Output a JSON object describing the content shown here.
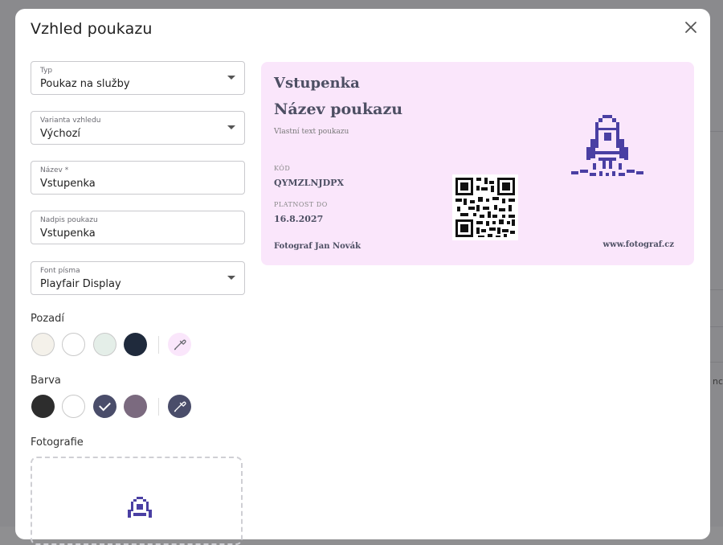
{
  "background": {
    "partial_text": "nc"
  },
  "modal": {
    "title": "Vzhled poukazu"
  },
  "fields": {
    "typ": {
      "label": "Typ",
      "value": "Poukaz na služby"
    },
    "varianta": {
      "label": "Varianta vzhledu",
      "value": "Výchozí"
    },
    "nazev": {
      "label": "Název *",
      "value": "Vstupenka"
    },
    "nadpis": {
      "label": "Nadpis poukazu",
      "value": "Vstupenka"
    },
    "font": {
      "label": "Font písma",
      "value": "Playfair Display"
    }
  },
  "background_colors": {
    "label": "Pozadí",
    "swatches": [
      "#f4f1ea",
      "#ffffff",
      "#e4eee8",
      "#1f2a3c"
    ],
    "custom_color": "#fae6fb",
    "icon": "eyedropper-icon"
  },
  "text_colors": {
    "label": "Barva",
    "swatches": [
      "#2d2d2d",
      "#ffffff",
      "#4a4d6a",
      "#7b6a7f"
    ],
    "selected_index": 2,
    "custom_color": "#4a4d6a",
    "icon": "eyedropper-icon"
  },
  "photo": {
    "label": "Fotografie",
    "icon": "rocket-icon"
  },
  "voucher": {
    "background": "#fae6fb",
    "accent": "#4a3fa3",
    "heading": "Vstupenka",
    "name": "Název poukazu",
    "custom_text": "Vlastní text poukazu",
    "code_label": "KÓD",
    "code": "QYMZLNJDPX",
    "validity_label": "PLATNOST DO",
    "validity": "16.8.2027",
    "photographer": "Fotograf Jan Novák",
    "website": "www.fotograf.cz",
    "qr_icon": "qr-code-icon",
    "logo_icon": "rocket-icon"
  }
}
